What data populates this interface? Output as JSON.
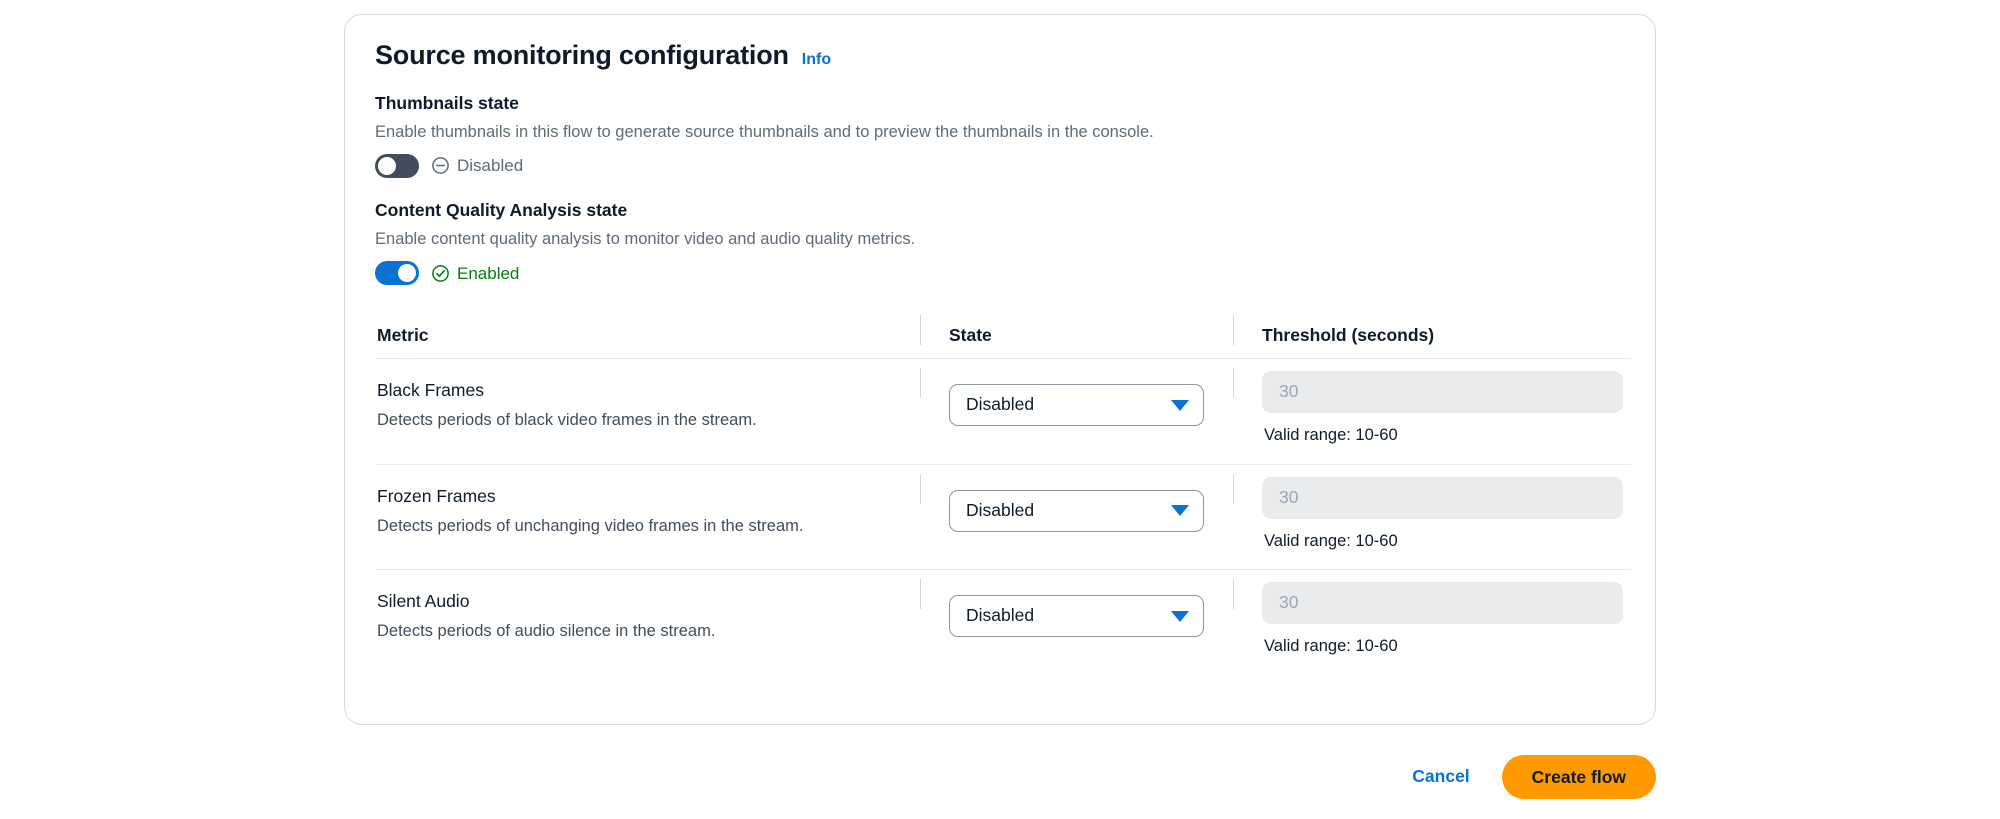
{
  "card": {
    "title": "Source monitoring configuration",
    "info_link": "Info"
  },
  "thumbnails": {
    "label": "Thumbnails state",
    "description": "Enable thumbnails in this flow to generate source thumbnails and to preview the thumbnails in the console.",
    "toggle_state": "off",
    "status_text": "Disabled",
    "status_icon": "circle-minus-icon",
    "status_color": "#5f6b7a"
  },
  "content_quality": {
    "label": "Content Quality Analysis state",
    "description": "Enable content quality analysis to monitor video and audio quality metrics.",
    "toggle_state": "on",
    "status_text": "Enabled",
    "status_icon": "circle-check-icon",
    "status_color": "#037f0c"
  },
  "table": {
    "headers": {
      "metric": "Metric",
      "state": "State",
      "threshold": "Threshold (seconds)"
    },
    "rows": [
      {
        "name": "Black Frames",
        "description": "Detects periods of black video frames in the stream.",
        "state_value": "Disabled",
        "threshold_placeholder": "30",
        "threshold_value": "",
        "threshold_hint": "Valid range: 10-60"
      },
      {
        "name": "Frozen Frames",
        "description": "Detects periods of unchanging video frames in the stream.",
        "state_value": "Disabled",
        "threshold_placeholder": "30",
        "threshold_value": "",
        "threshold_hint": "Valid range: 10-60"
      },
      {
        "name": "Silent Audio",
        "description": "Detects periods of audio silence in the stream.",
        "state_value": "Disabled",
        "threshold_placeholder": "30",
        "threshold_value": "",
        "threshold_hint": "Valid range: 10-60"
      }
    ]
  },
  "footer": {
    "cancel_label": "Cancel",
    "create_label": "Create flow",
    "create_color": "#ff9900",
    "cancel_color": "#0972d3"
  }
}
